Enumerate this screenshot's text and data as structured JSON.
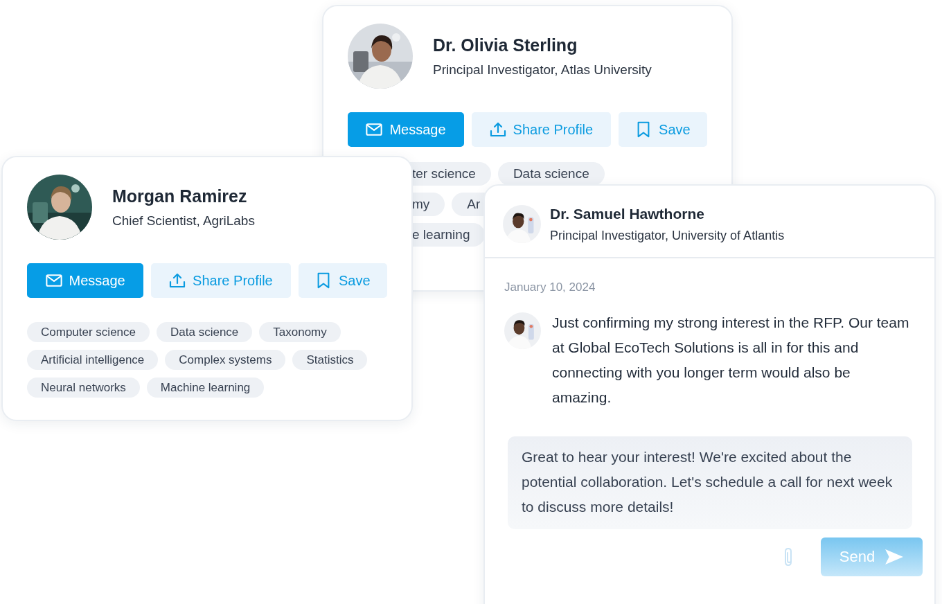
{
  "profiles": [
    {
      "name": "Dr. Olivia Sterling",
      "title": "Principal Investigator, Atlas University",
      "actions": [
        {
          "label": "Message",
          "kind": "message"
        },
        {
          "label": "Share Profile",
          "kind": "share"
        },
        {
          "label": "Save",
          "kind": "save"
        }
      ],
      "tag_rows": [
        [
          "ter science",
          "Data science"
        ],
        [
          "my",
          "Ar"
        ],
        [
          "e learning"
        ]
      ]
    },
    {
      "name": "Morgan Ramirez",
      "title": "Chief Scientist, AgriLabs",
      "actions": [
        {
          "label": "Message",
          "kind": "message"
        },
        {
          "label": "Share Profile",
          "kind": "share"
        },
        {
          "label": "Save",
          "kind": "save"
        }
      ],
      "tag_rows": [
        [
          "Computer science",
          "Data science",
          "Taxonomy"
        ],
        [
          "Artificial intelligence",
          "Complex systems",
          "Statistics"
        ],
        [
          "Neural networks",
          "Machine learning"
        ]
      ]
    }
  ],
  "chat": {
    "contact": {
      "name": "Dr. Samuel Hawthorne",
      "title": "Principal Investigator, University of Atlantis"
    },
    "date": "January 10, 2024",
    "message": {
      "text": "Just confirming my strong interest in the RFP. Our team at Global EcoTech Solutions is all in for this and connecting with you longer term would also be amazing."
    },
    "reply": {
      "value": "Great to hear your interest! We're excited about the potential collaboration. Let's schedule a call for next week to discuss more details!"
    },
    "send": {
      "label": "Send"
    }
  }
}
